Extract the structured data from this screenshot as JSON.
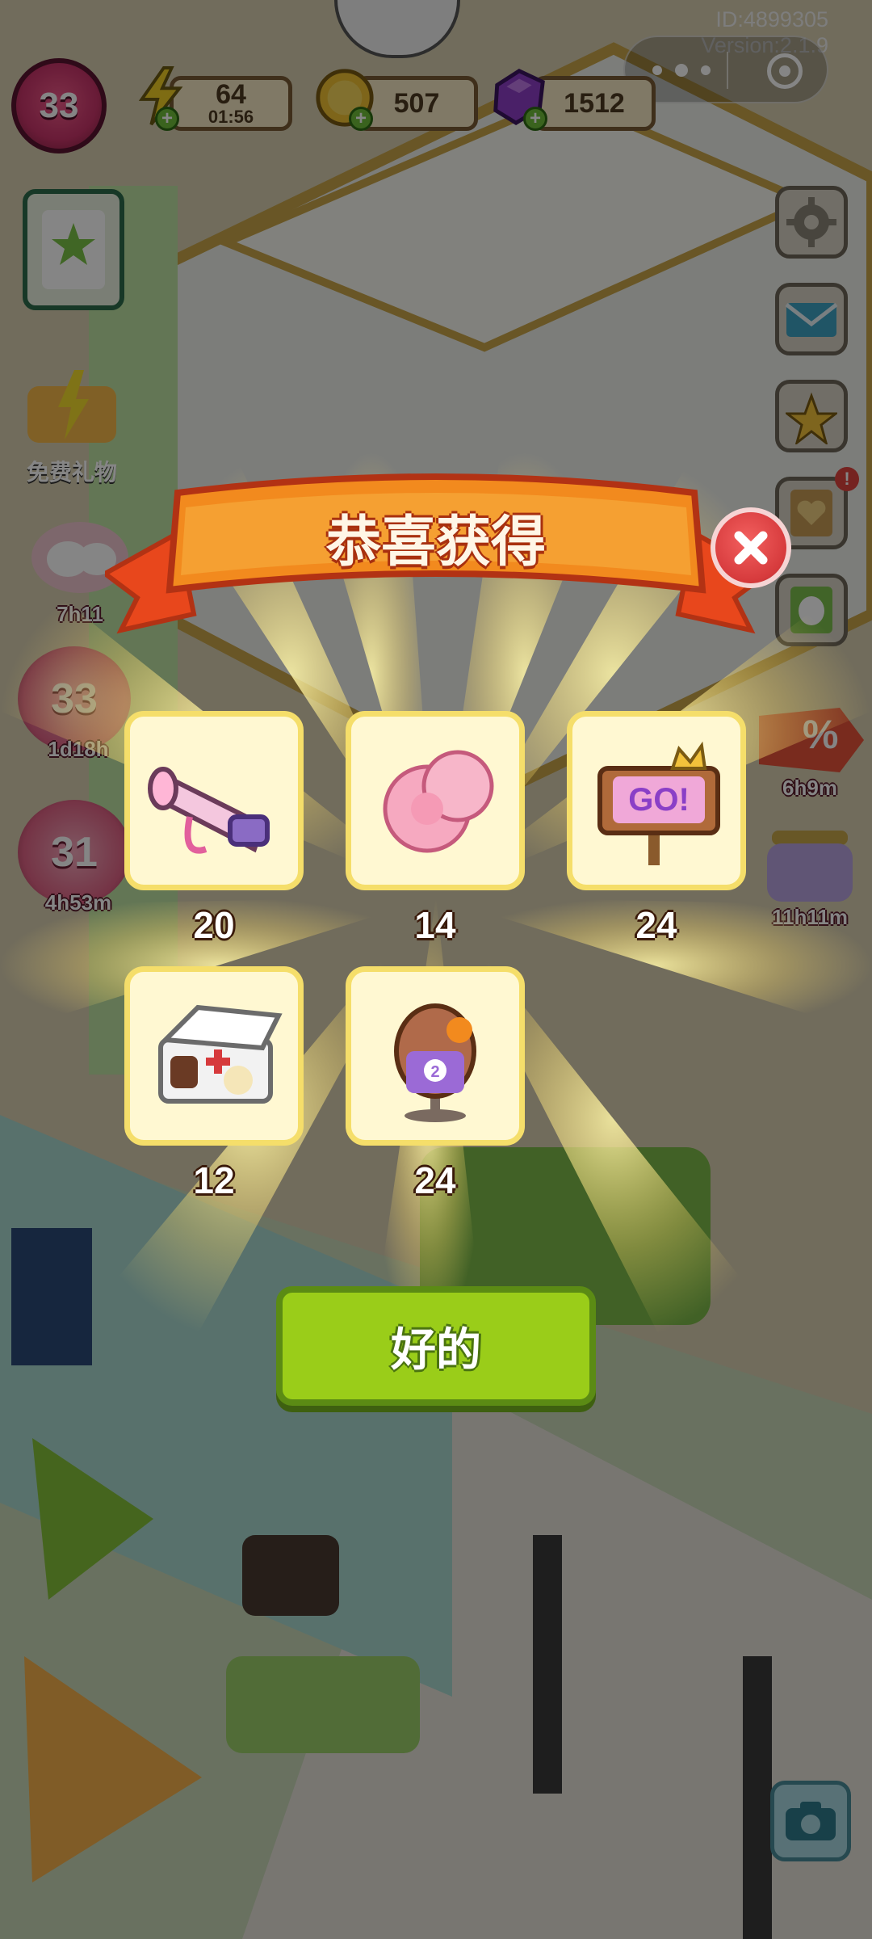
{
  "meta": {
    "id": "ID:4899305",
    "version": "Version:2.1.9"
  },
  "hud": {
    "level": "33",
    "energy": {
      "value": "64",
      "timer": "01:56",
      "icon": "lightning-icon"
    },
    "coins": {
      "value": "507",
      "icon": "coin-icon"
    },
    "gems": {
      "value": "1512",
      "icon": "gem-icon"
    }
  },
  "left_panel": {
    "gift_label": "免费礼物",
    "event_timer": "7h11",
    "level_event_1": {
      "level": "33",
      "timer": "1d18h"
    },
    "level_event_2": {
      "level": "31",
      "timer": "4h53m"
    }
  },
  "right_panel": {
    "discount_timer": "6h9m",
    "jar_timer": "11h11m",
    "discount_label": "%"
  },
  "dialog": {
    "title": "恭喜获得",
    "ok_label": "好的",
    "rewards": [
      {
        "name": "megaphone",
        "count": "20"
      },
      {
        "name": "pompom",
        "count": "14"
      },
      {
        "name": "go-sign",
        "count": "24"
      },
      {
        "name": "first-aid-kit",
        "count": "12"
      },
      {
        "name": "jersey-trophy",
        "count": "24"
      }
    ]
  },
  "colors": {
    "accent_green": "#9acd19",
    "banner_red": "#e8471c",
    "tile_border": "#f5de6a"
  }
}
